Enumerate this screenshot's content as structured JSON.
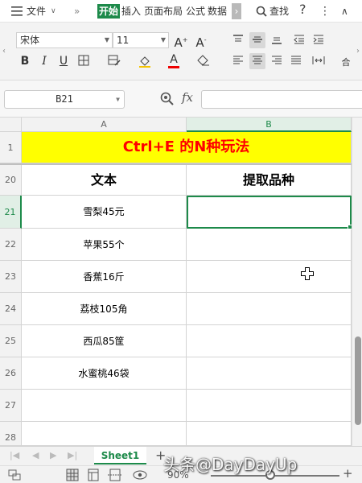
{
  "menu": {
    "file": "文件",
    "tabs": [
      "开始",
      "插入",
      "页面布局",
      "公式",
      "数据"
    ],
    "search": "查找"
  },
  "ribbon": {
    "font_name": "宋体",
    "font_size": "11"
  },
  "formula_bar": {
    "cell_ref": "B21",
    "fx_label": "fx",
    "value": ""
  },
  "columns": [
    "A",
    "B"
  ],
  "title_row": {
    "row": "1",
    "text": "Ctrl+E 的N种玩法"
  },
  "header_row": {
    "row": "20",
    "col_a": "文本",
    "col_b": "提取品种"
  },
  "rows": [
    {
      "row": "21",
      "a": "雪梨45元",
      "b": ""
    },
    {
      "row": "22",
      "a": "苹果55个",
      "b": ""
    },
    {
      "row": "23",
      "a": "香蕉16斤",
      "b": ""
    },
    {
      "row": "24",
      "a": "荔枝105角",
      "b": ""
    },
    {
      "row": "25",
      "a": "西瓜85筐",
      "b": ""
    },
    {
      "row": "26",
      "a": "水蜜桃46袋",
      "b": ""
    },
    {
      "row": "27",
      "a": "",
      "b": ""
    },
    {
      "row": "28",
      "a": "",
      "b": ""
    }
  ],
  "sheets": {
    "active": "Sheet1",
    "add": "+"
  },
  "status": {
    "zoom": "90%"
  },
  "watermark": "头条@DayDayUp",
  "colors": {
    "accent": "#1d8a4a",
    "title_bg": "#ffff00",
    "title_text": "#ff0000"
  }
}
